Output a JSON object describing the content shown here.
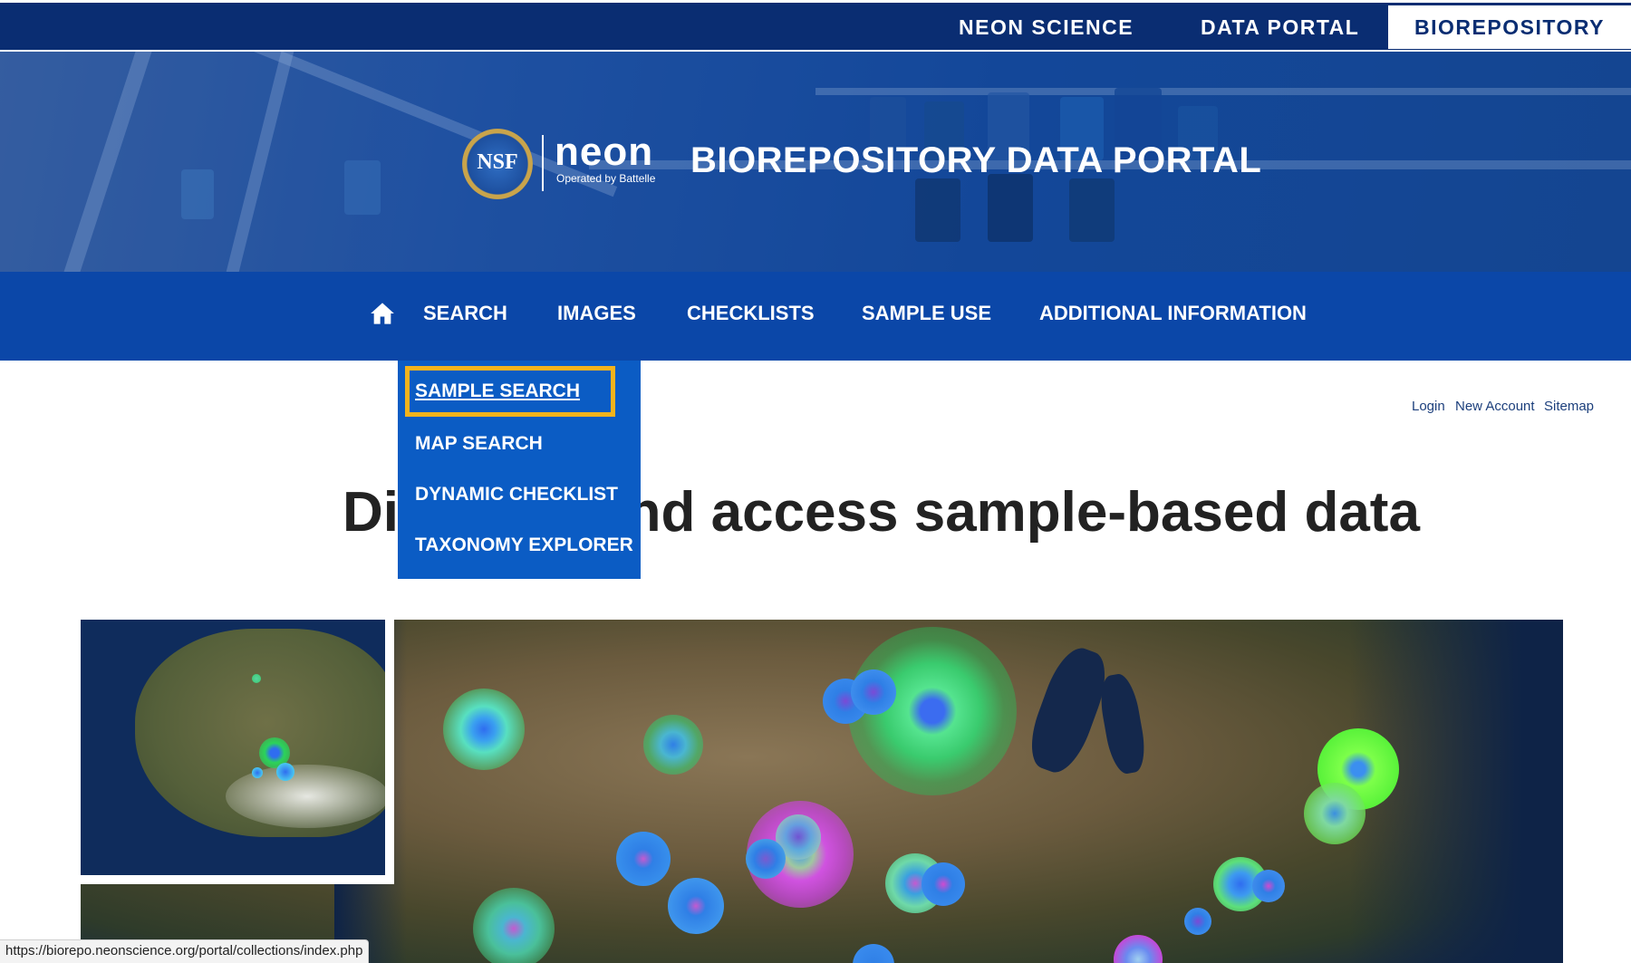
{
  "topbar": {
    "links": [
      "NEON SCIENCE",
      "DATA PORTAL",
      "BIOREPOSITORY"
    ],
    "active": "BIOREPOSITORY"
  },
  "header": {
    "seal_text": "NSF",
    "brand_name": "neon",
    "brand_tagline": "Operated by Battelle",
    "portal_title": "BIOREPOSITORY DATA PORTAL"
  },
  "nav": {
    "home_icon": "home-icon",
    "items": [
      "SEARCH",
      "IMAGES",
      "CHECKLISTS",
      "SAMPLE USE",
      "ADDITIONAL INFORMATION"
    ]
  },
  "dropdown": {
    "items": [
      "SAMPLE SEARCH",
      "MAP SEARCH",
      "DYNAMIC CHECKLIST",
      "TAXONOMY EXPLORER"
    ],
    "focused": "SAMPLE SEARCH"
  },
  "utility": {
    "login": "Login",
    "new_account": "New Account",
    "sitemap": "Sitemap"
  },
  "main": {
    "heading": "Discover and access sample-based data"
  },
  "status_bar": {
    "url": "https://biorepo.neonscience.org/portal/collections/index.php"
  },
  "colors": {
    "topbar": "#0a2d72",
    "nav": "#0b47a8",
    "dropdown": "#0b5cc4",
    "focus_ring": "#f2b31c",
    "heading_text": "#222222",
    "marker_green": "#2bd35a",
    "marker_blue": "#2f7fe6",
    "marker_purple": "#c34ad8"
  }
}
